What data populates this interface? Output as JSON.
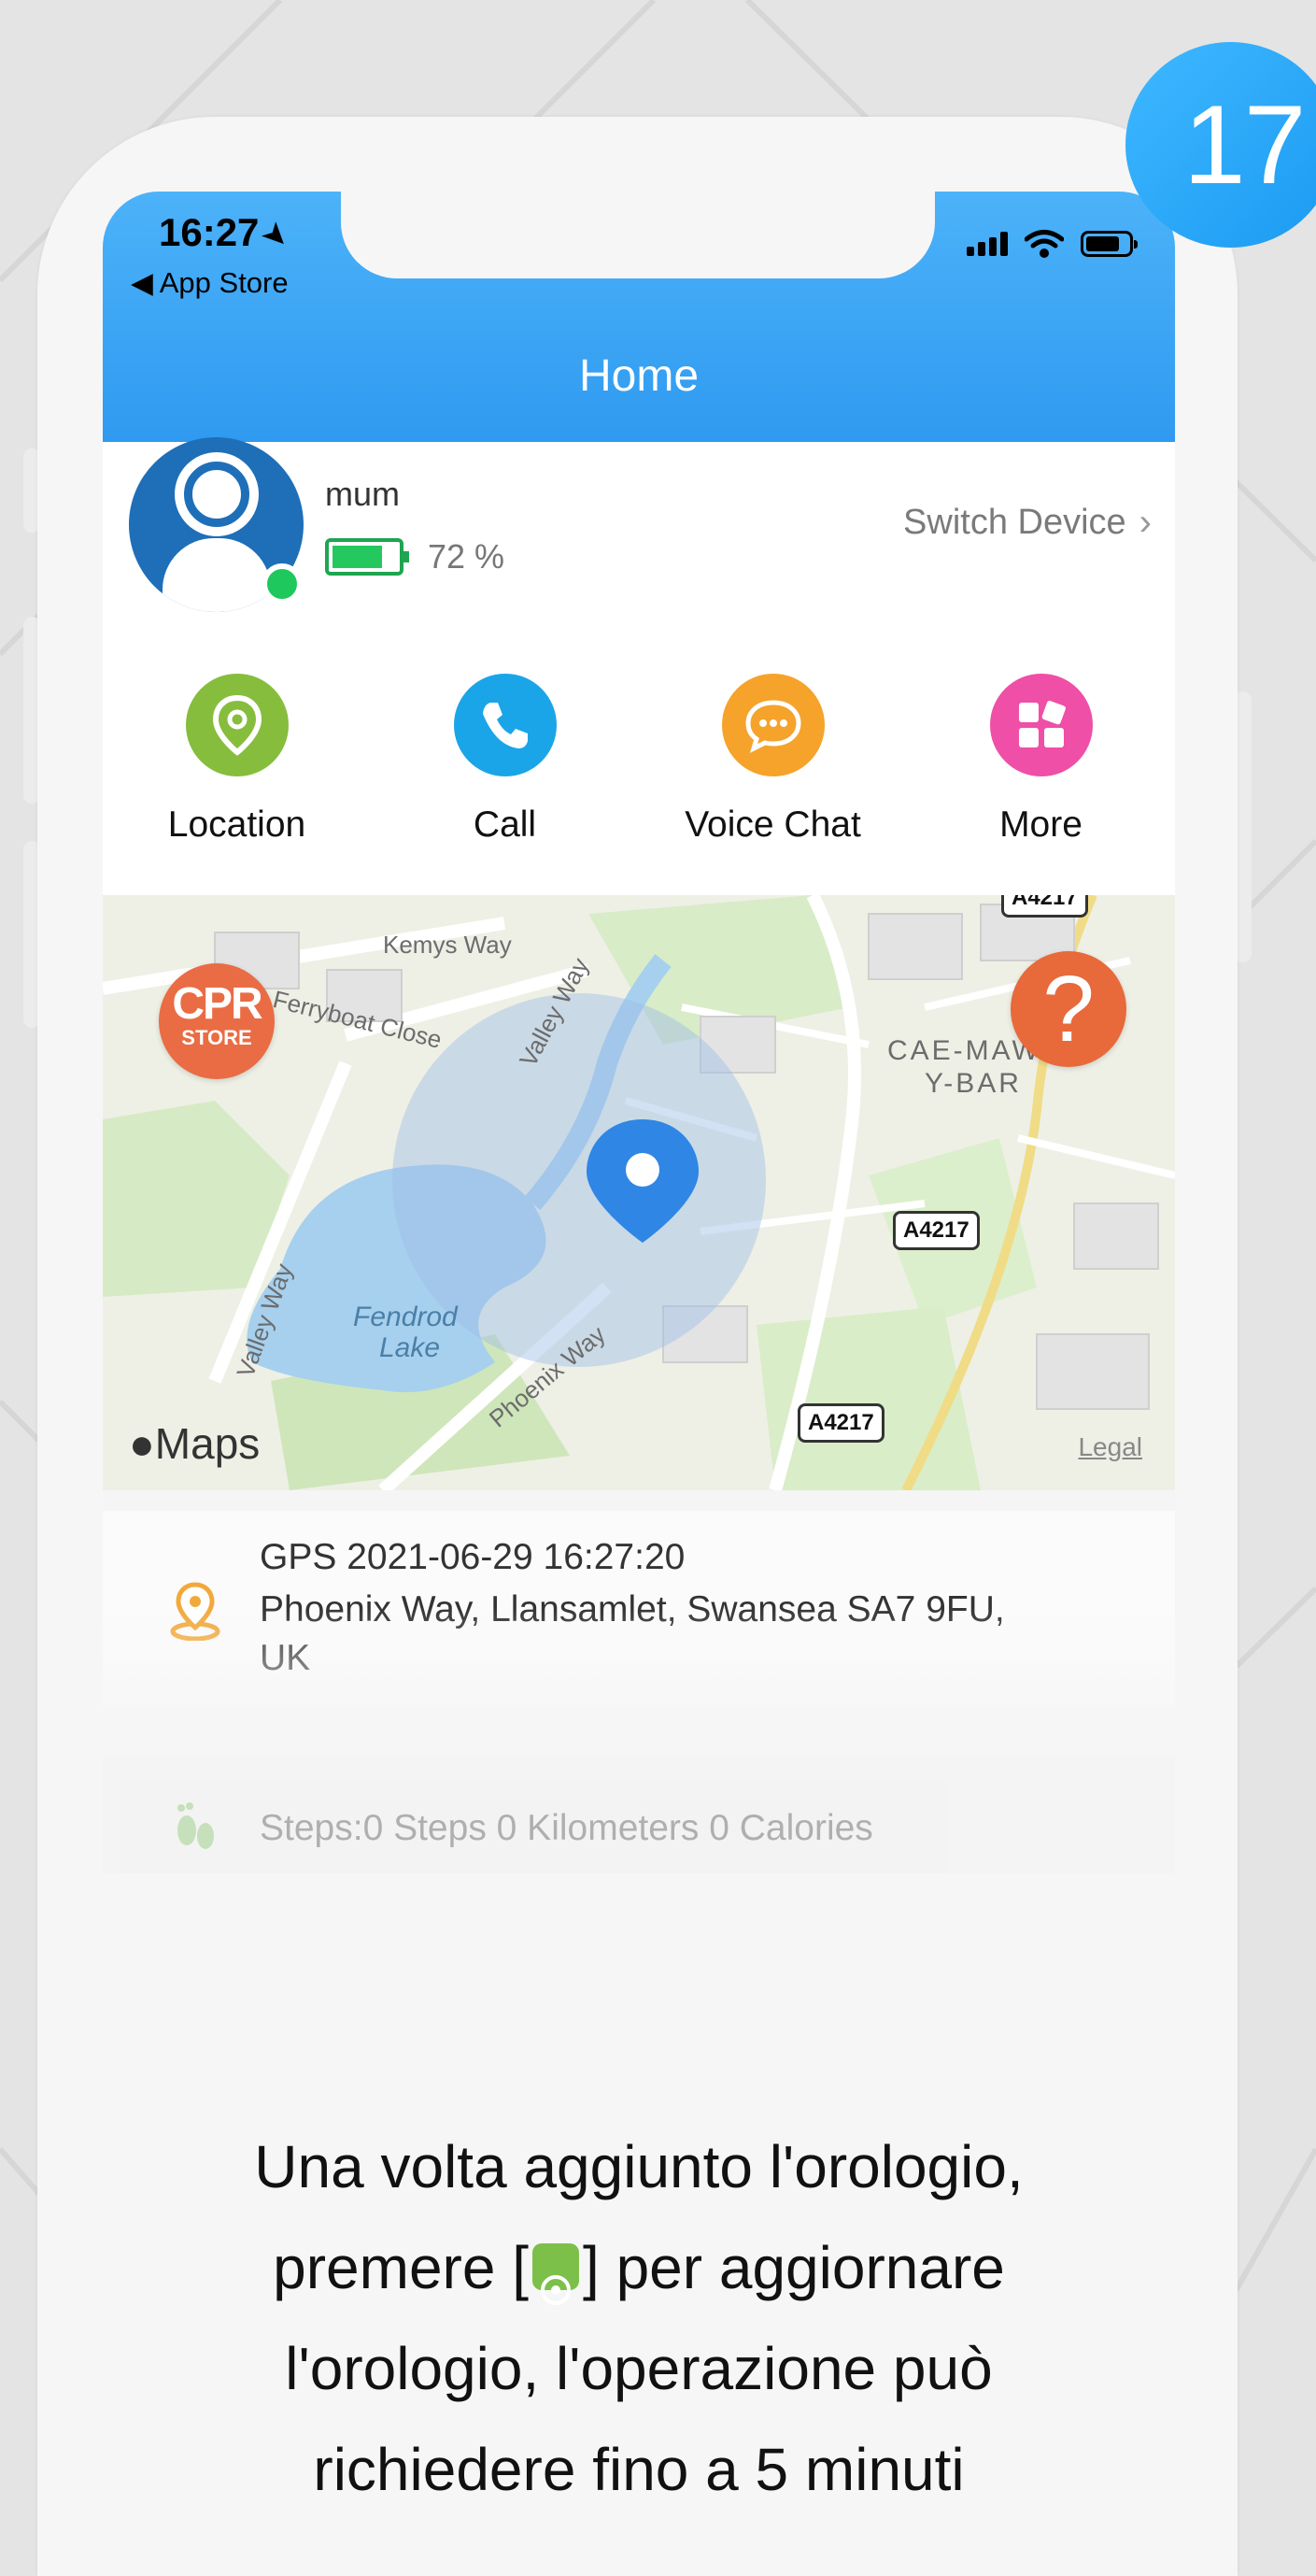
{
  "step_number": "17",
  "status_bar": {
    "time": "16:27",
    "back_label": "App Store"
  },
  "header": {
    "title": "Home"
  },
  "device": {
    "name": "mum",
    "battery": "72 %",
    "switch_label": "Switch Device"
  },
  "quick_actions": [
    {
      "label": "Location",
      "color": "#86bd3d"
    },
    {
      "label": "Call",
      "color": "#1aa5e8"
    },
    {
      "label": "Voice Chat",
      "color": "#f5a32a"
    },
    {
      "label": "More",
      "color": "#ef4fa6"
    }
  ],
  "map": {
    "labels": {
      "kemys_way": "Kemys Way",
      "ferryboat_close": "Ferryboat Close",
      "valley_way_top": "Valley Way",
      "valley_way_left": "Valley Way",
      "cae_mawr_line1": "CAE-MAW",
      "cae_mawr_line2": "Y-BAR",
      "fendrod_lake_line1": "Fendrod",
      "fendrod_lake_line2": "Lake",
      "phoenix_way": "Phoenix Way"
    },
    "road_badges": {
      "a4217_top": "A4217",
      "a4217_mid": "A4217",
      "a4217_bottom": "A4217"
    },
    "cpr_store": {
      "logo": "CPR",
      "sub": "STORE"
    },
    "help_symbol": "?",
    "brand": "Maps",
    "legal": "Legal"
  },
  "location": {
    "timestamp": "GPS 2021-06-29 16:27:20",
    "address": "Phoenix Way, Llansamlet, Swansea SA7 9FU, UK"
  },
  "steps": {
    "text": "Steps:0 Steps 0 Kilometers 0 Calories"
  },
  "caption": {
    "line1": "Una volta aggiunto l'orologio,",
    "line2_before": "premere [",
    "line2_after": "] per aggiornare",
    "line3": "l'orologio, l'operazione può",
    "line4": "richiedere fino a 5 minuti"
  },
  "colors": {
    "accent_blue": "#2f9af0",
    "badge_blue": "#1a9af2",
    "online_green": "#1ec85c",
    "help_orange": "#e8693a"
  }
}
